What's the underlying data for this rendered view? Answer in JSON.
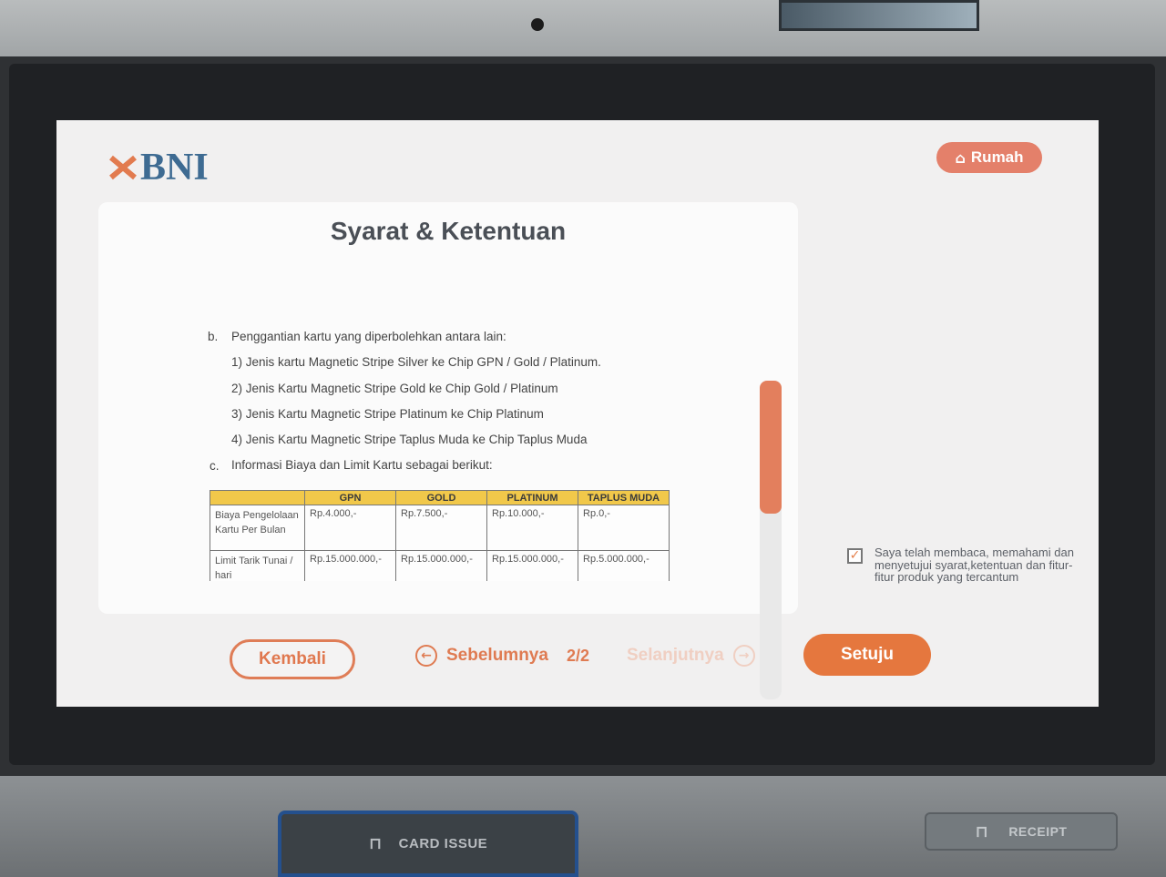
{
  "brand": {
    "logo_text": "BNI"
  },
  "header": {
    "home_label": "Rumah",
    "home_icon": "home-icon"
  },
  "page": {
    "title": "Syarat & Ketentuan",
    "lines": [
      {
        "marker": "b.",
        "text": "Penggantian kartu yang diperbolehkan antara lain:"
      },
      {
        "marker": "",
        "text": "1) Jenis kartu Magnetic Stripe Silver ke Chip GPN / Gold / Platinum."
      },
      {
        "marker": "",
        "text": "2) Jenis Kartu Magnetic Stripe Gold ke Chip Gold / Platinum"
      },
      {
        "marker": "",
        "text": "3) Jenis Kartu Magnetic Stripe Platinum ke Chip Platinum"
      },
      {
        "marker": "",
        "text": "4) Jenis Kartu Magnetic Stripe Taplus Muda ke Chip Taplus Muda"
      },
      {
        "marker": "c.",
        "text": "Informasi Biaya dan Limit Kartu sebagai berikut:"
      }
    ],
    "table": {
      "columns": [
        "",
        "GPN",
        "GOLD",
        "PLATINUM",
        "TAPLUS MUDA"
      ],
      "rows": [
        {
          "label": "Biaya Pengelolaan Kartu Per Bulan",
          "values": [
            "Rp.4.000,-",
            "Rp.7.500,-",
            "Rp.10.000,-",
            "Rp.0,-"
          ]
        },
        {
          "label": "Limit Tarik Tunai / hari",
          "values": [
            "Rp.15.000.000,-",
            "Rp.15.000.000,-",
            "Rp.15.000.000,-",
            "Rp.5.000.000,-"
          ]
        }
      ]
    }
  },
  "agreement": {
    "checked": true,
    "text": "Saya telah membaca, memahami dan menyetujui syarat,ketentuan dan fitur-fitur produk yang tercantum"
  },
  "footer": {
    "back_label": "Kembali",
    "prev_label": "Sebelumnya",
    "page_indicator": "2/2",
    "next_label": "Selanjutnya",
    "agree_label": "Setuju"
  },
  "hardware": {
    "card_slot_label": "CARD ISSUE",
    "receipt_slot_label": "RECEIPT"
  },
  "colors": {
    "accent": "#e5773e",
    "brand_blue": "#3e6b92",
    "table_header": "#f1c84a"
  }
}
